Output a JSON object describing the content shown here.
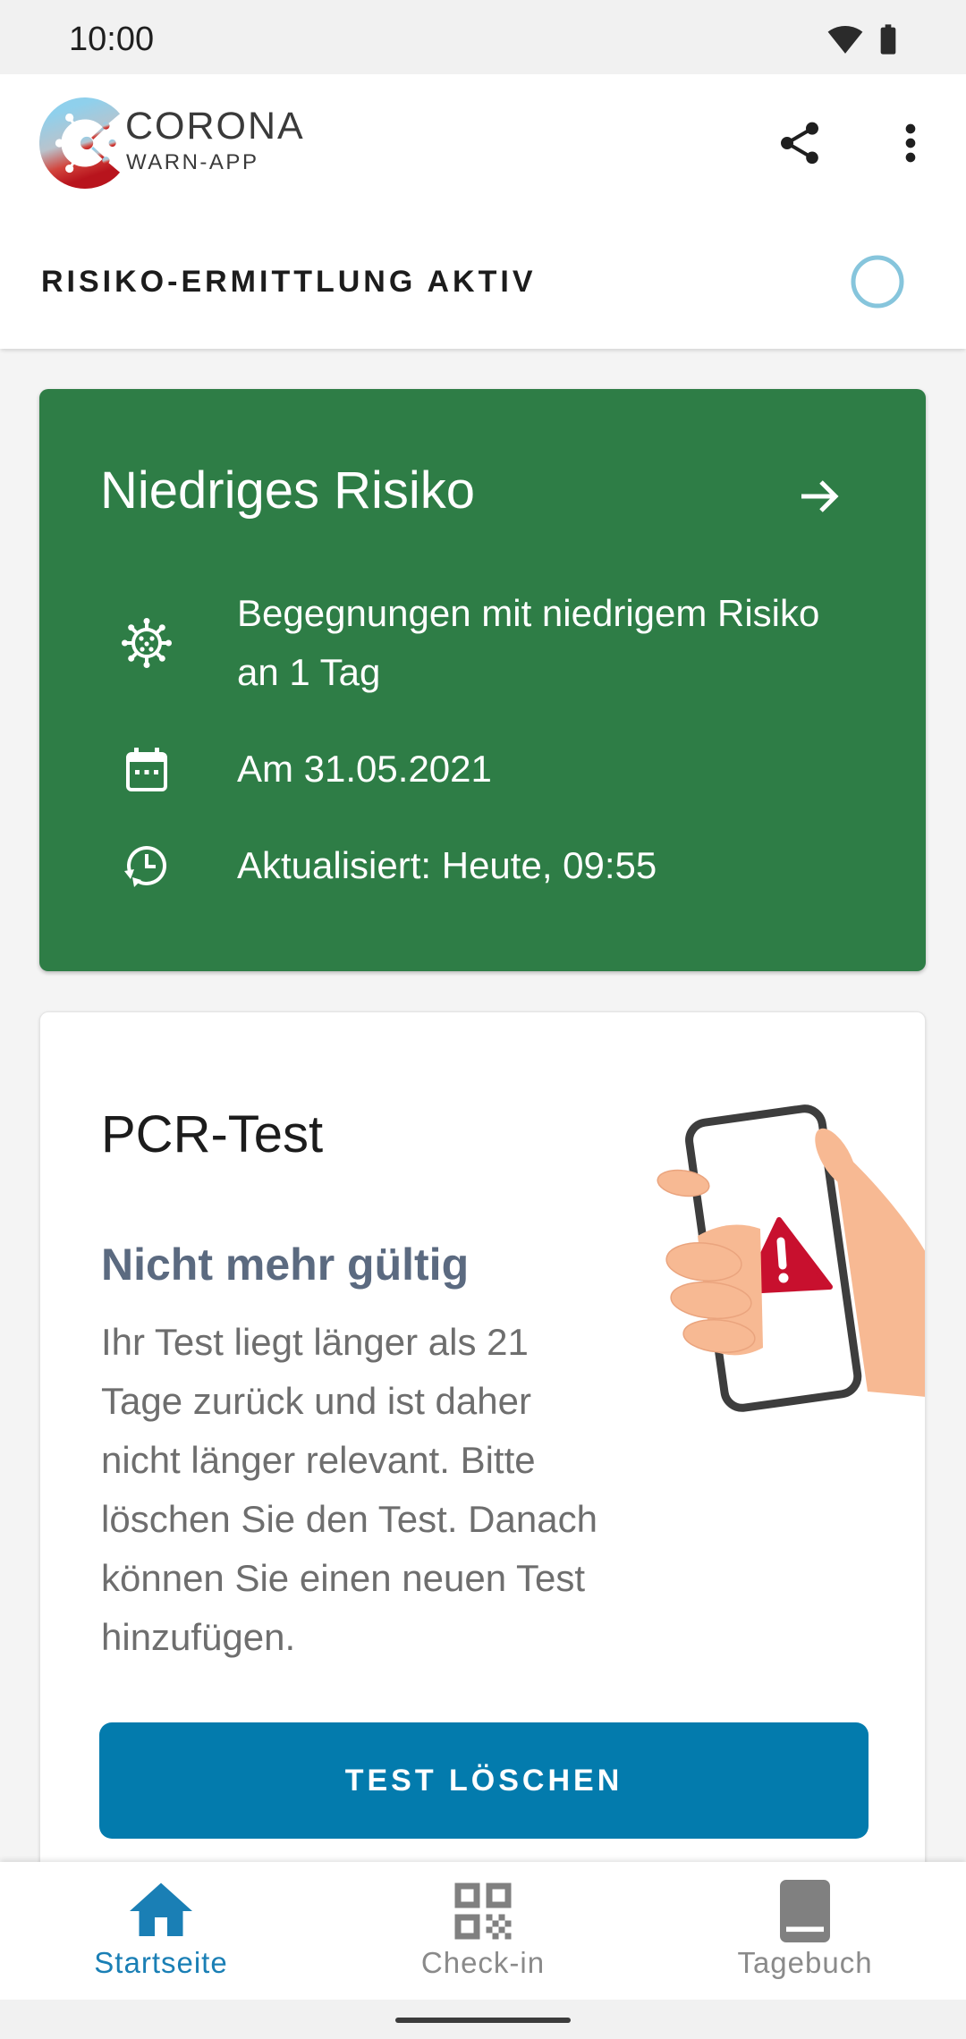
{
  "status_bar": {
    "time": "10:00",
    "icons": [
      "wifi-icon",
      "battery-icon"
    ]
  },
  "header": {
    "logo_title": "CORONA",
    "logo_subtitle": "WARN-APP",
    "actions": [
      "share-icon",
      "more-vert-icon"
    ],
    "risk_detection_label": "RISIKO-ERMITTLUNG AKTIV",
    "indicator_color": "#86c5dc"
  },
  "risk_card": {
    "title": "Niedriges Risiko",
    "background_color": "#2e7d46",
    "rows": [
      {
        "icon": "virus-icon",
        "lines": [
          "Begegnungen mit niedrigem Risiko",
          "an 1 Tag"
        ]
      },
      {
        "icon": "calendar-icon",
        "lines": [
          "Am 31.05.2021"
        ]
      },
      {
        "icon": "history-clock-icon",
        "lines": [
          "Aktualisiert: Heute, 09:55"
        ]
      }
    ]
  },
  "test_card": {
    "title": "PCR-Test",
    "status": "Nicht mehr gültig",
    "status_color": "#5b6a80",
    "illustration": "hand-holding-phone-warning-illustration",
    "body_lines": [
      "Ihr Test liegt länger als 21",
      "Tage zurück und ist daher",
      "nicht länger relevant. Bitte",
      "löschen Sie den Test. Danach",
      "können Sie einen neuen Test",
      "hinzufügen."
    ],
    "button_label": "TEST LÖSCHEN",
    "button_color": "#037bad"
  },
  "bottom_nav": {
    "active_color": "#1a7fb5",
    "inactive_color": "#8a8a8a",
    "items": [
      {
        "label": "Startseite",
        "icon": "home-icon",
        "active": true
      },
      {
        "label": "Check-in",
        "icon": "qr-code-icon",
        "active": false
      },
      {
        "label": "Tagebuch",
        "icon": "book-icon",
        "active": false
      }
    ]
  }
}
